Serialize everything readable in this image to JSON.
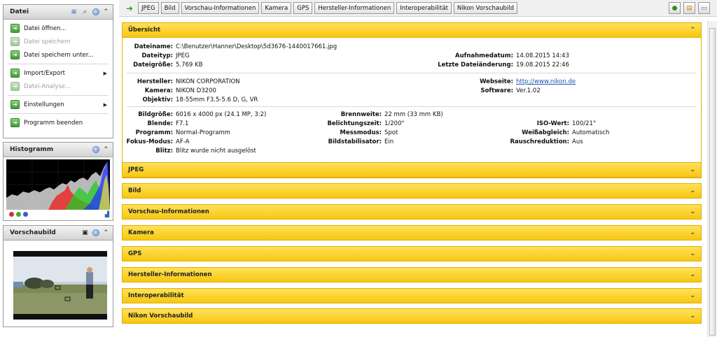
{
  "sidebar": {
    "datei": {
      "title": "Datei",
      "items": [
        {
          "label": "Datei öffnen...",
          "disabled": false,
          "submenu": false
        },
        {
          "label": "Datei speichern",
          "disabled": true,
          "submenu": false
        },
        {
          "label": "Datei speichern unter...",
          "disabled": false,
          "submenu": false
        },
        {
          "label": "Import/Export",
          "disabled": false,
          "submenu": true
        },
        {
          "label": "Datei-Analyse...",
          "disabled": true,
          "submenu": false
        },
        {
          "label": "Einstellungen",
          "disabled": false,
          "submenu": true
        },
        {
          "label": "Programm beenden",
          "disabled": false,
          "submenu": false
        }
      ]
    },
    "histogramm": {
      "title": "Histogramm"
    },
    "vorschaubild": {
      "title": "Vorschaubild"
    }
  },
  "toolbar": {
    "tabs": [
      "JPEG",
      "Bild",
      "Vorschau-Informationen",
      "Kamera",
      "GPS",
      "Hersteller-Informationen",
      "Interoperabilität",
      "Nikon Vorschaubild"
    ]
  },
  "overview": {
    "title": "Übersicht",
    "file": {
      "dateiname_label": "Dateiname:",
      "dateiname": "C:\\Benutzer\\Hanner\\Desktop\\5d3676-1440017661.jpg",
      "dateityp_label": "Dateityp:",
      "dateityp": "JPEG",
      "dateigroesse_label": "Dateigröße:",
      "dateigroesse": "5.769 KB",
      "aufnahmedatum_label": "Aufnahmedatum:",
      "aufnahmedatum": "14.08.2015 14:43",
      "letzte_label": "Letzte Dateiänderung:",
      "letzte": "19.08.2015 22:46"
    },
    "camera": {
      "hersteller_label": "Hersteller:",
      "hersteller": "NIKON CORPORATION",
      "kamera_label": "Kamera:",
      "kamera": "NIKON D3200",
      "objektiv_label": "Objektiv:",
      "objektiv": "18-55mm F3.5-5.6 D, G, VR",
      "webseite_label": "Webseite:",
      "webseite": "http://www.nikon.de",
      "software_label": "Software:",
      "software": "Ver.1.02"
    },
    "exposure": {
      "bildgroesse_label": "Bildgröße:",
      "bildgroesse": "6016 x 4000 px (24.1 MP, 3:2)",
      "blende_label": "Blende:",
      "blende": "F7.1",
      "programm_label": "Programm:",
      "programm": "Normal-Programm",
      "fokus_label": "Fokus-Modus:",
      "fokus": "AF-A",
      "blitz_label": "Blitz:",
      "blitz": "Blitz wurde nicht ausgelöst",
      "brennweite_label": "Brennweite:",
      "brennweite": "22 mm (33 mm KB)",
      "belichtung_label": "Belichtungszeit:",
      "belichtung": "1/200\"",
      "messmodus_label": "Messmodus:",
      "messmodus": "Spot",
      "stabilisator_label": "Bildstabilisator:",
      "stabilisator": "Ein",
      "iso_label": "ISO-Wert:",
      "iso": "100/21°",
      "weiss_label": "Weißabgleich:",
      "weiss": "Automatisch",
      "rausch_label": "Rauschreduktion:",
      "rausch": "Aus"
    }
  },
  "sections": [
    "JPEG",
    "Bild",
    "Vorschau-Informationen",
    "Kamera",
    "GPS",
    "Hersteller-Informationen",
    "Interoperabilität",
    "Nikon Vorschaubild"
  ],
  "colors": {
    "section_yellow": "#f9d12c",
    "link_blue": "#1a56b3",
    "menu_green": "#4aa33f"
  }
}
